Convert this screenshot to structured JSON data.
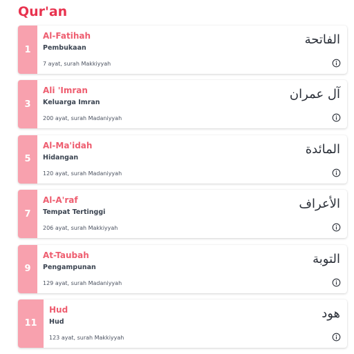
{
  "app": {
    "title": "Qur'an"
  },
  "surahs": [
    {
      "number": "1",
      "latin": "Al-Fatihah",
      "translation": "Pembukaan",
      "info": "7 ayat, surah Makkiyyah",
      "arabic": "الفاتحة"
    },
    {
      "number": "3",
      "latin": "Ali 'Imran",
      "translation": "Keluarga Imran",
      "info": "200 ayat, surah Madaniyyah",
      "arabic": "آل عمران"
    },
    {
      "number": "5",
      "latin": "Al-Ma'idah",
      "translation": "Hidangan",
      "info": "120 ayat, surah Madaniyyah",
      "arabic": "المائدة"
    },
    {
      "number": "7",
      "latin": "Al-A'raf",
      "translation": "Tempat Tertinggi",
      "info": "206 ayat, surah Makkiyyah",
      "arabic": "الأعراف"
    },
    {
      "number": "9",
      "latin": "At-Taubah",
      "translation": "Pengampunan",
      "info": "129 ayat, surah Madaniyyah",
      "arabic": "التوبة"
    },
    {
      "number": "11",
      "latin": "Hud",
      "translation": "Hud",
      "info": "123 ayat, surah Makkiyyah",
      "arabic": "هود"
    }
  ],
  "icons": {
    "info": "info-circle-icon"
  },
  "colors": {
    "accent": "#e8334f",
    "number_badge": "#f8a1ae",
    "surah_name": "#ee5d6f"
  }
}
